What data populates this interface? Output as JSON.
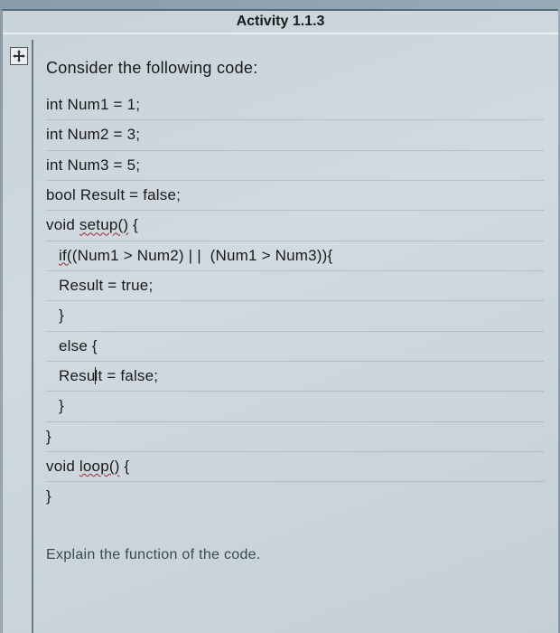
{
  "title": "Activity 1.1.3",
  "intro": "Consider the following code:",
  "code": {
    "l1": "int Num1 = 1;",
    "l2": "int Num2 = 3;",
    "l3": "int Num3 = 5;",
    "l4": "bool Result = false;",
    "l5_pre": "void ",
    "l5_fn": "setup()",
    "l5_post": " {",
    "l6_pre": "if(",
    "l6_post": "(Num1 > Num2) | |  (Num1 > Num3)){",
    "l7": "Result = true;",
    "l8": "}",
    "l9": "else {",
    "l10_a": "Resu",
    "l10_b": "lt = false;",
    "l11": "}",
    "l12": "}",
    "l13_pre": "void ",
    "l13_fn": "loop()",
    "l13_post": " {",
    "l14": "}"
  },
  "explain": "Explain the function of the code."
}
